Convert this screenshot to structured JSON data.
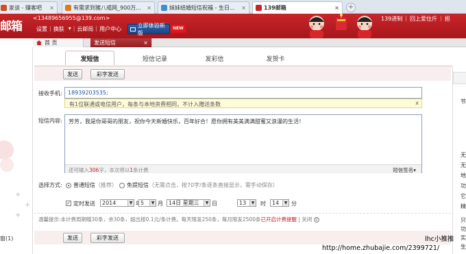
{
  "browser": {
    "tabs": [
      {
        "label": "家谈 - 赚客吧",
        "favicon_color": "#d24b2b"
      },
      {
        "label": "有需求到猪八戒网_900万...",
        "favicon_color": "#e07a1d"
      },
      {
        "label": "妹妹结婚短信祝福 - 生日...",
        "favicon_color": "#3d8ed8"
      },
      {
        "label": "139邮箱",
        "favicon_color": "#c8252a"
      }
    ],
    "new_tab": "+"
  },
  "header": {
    "logo": "邮箱",
    "user": "<13489656955@139.com>",
    "links": [
      "设置",
      "换肤",
      "云邮局",
      "用户中心"
    ],
    "try_button": "立即体验新版",
    "new_badge": "NEW",
    "right_links": [
      "139进制",
      "回上爱住斤",
      "担"
    ]
  },
  "page_tabs": {
    "home": "首 页",
    "current": "发送短信",
    "close": "×"
  },
  "sub_tabs": [
    "发短信",
    "短信记录",
    "发彩信",
    "发贺卡"
  ],
  "toolbar": {
    "send": "发送",
    "color_send": "彩字发送"
  },
  "form": {
    "recipient_label": "接收手机:",
    "recipient_value": "18939203535;",
    "hint": "有1位联通或电信用户，每条与本地资费相同，不计入赠送条数",
    "hint_close": "x",
    "content_label": "短信内容:",
    "content": "芳芳，我是你哥哥的朋友，祝你今天新婚快乐，百年好合！愿你拥有美美满满甜蜜又浪漫的生活！",
    "counter_prefix": "还可输入",
    "counter_num": "306",
    "counter_suffix": "字，本次将以",
    "counter_count": "1",
    "counter_end": "条计费",
    "signature": "短信签名"
  },
  "options": {
    "mode_label": "选择方式:",
    "normal": "普通短信",
    "normal_note": "（推荐）",
    "flash": "免提短信",
    "flash_note": "（无需点击，按70字/条逐条直接显示，需手动保存）",
    "timed_label": "定时发送",
    "year": "2014",
    "year_unit": "年",
    "month": "5",
    "month_unit": "月",
    "day": "14日 星期三",
    "day_unit": "日",
    "hour": "13",
    "hour_unit": "时",
    "minute": "14",
    "minute_unit": "分"
  },
  "tip": {
    "text": "温馨提示:本计费周期赠30条，余30条，超出按0.1元/条计费。每天限发250条，每月限发2500条",
    "link": "已开启计费提醒",
    "close": "关闭",
    "help": "?"
  },
  "left_panel": {
    "text": "窗(1)"
  },
  "right_panel": {
    "lines": [
      "节",
      "无",
      "无",
      "地",
      "功",
      "它",
      "精",
      "只",
      "功",
      "实",
      "生"
    ]
  },
  "watermark": {
    "url": "http://home.zhubajie.com/2399721/",
    "name": "lhc小推推"
  }
}
